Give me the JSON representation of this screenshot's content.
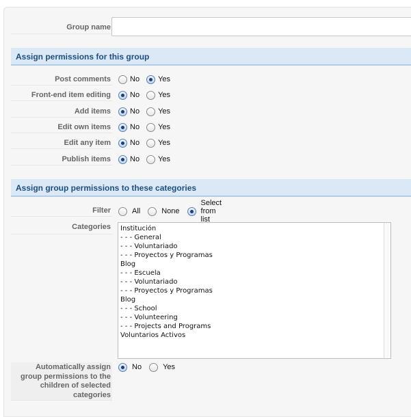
{
  "group_name": {
    "label": "Group name",
    "value": ""
  },
  "section_permissions": {
    "title": "Assign permissions for this group"
  },
  "permissions": [
    {
      "label": "Post comments",
      "options": [
        "No",
        "Yes"
      ],
      "selected": "Yes"
    },
    {
      "label": "Front-end item editing",
      "options": [
        "No",
        "Yes"
      ],
      "selected": "No"
    },
    {
      "label": "Add items",
      "options": [
        "No",
        "Yes"
      ],
      "selected": "No"
    },
    {
      "label": "Edit own items",
      "options": [
        "No",
        "Yes"
      ],
      "selected": "No"
    },
    {
      "label": "Edit any item",
      "options": [
        "No",
        "Yes"
      ],
      "selected": "No"
    },
    {
      "label": "Publish items",
      "options": [
        "No",
        "Yes"
      ],
      "selected": "No"
    }
  ],
  "section_categories": {
    "title": "Assign group permissions to these categories"
  },
  "filter": {
    "label": "Filter",
    "options": [
      "All",
      "None",
      "Select from list"
    ],
    "selected": "Select from list"
  },
  "categories": {
    "label": "Categories",
    "items": [
      "Institución",
      "- - - General",
      "- - - Voluntariado",
      "- - - Proyectos y Programas",
      "Blog",
      "- - - Escuela",
      "- - - Voluntariado",
      "- - - Proyectos y Programas",
      "Blog",
      "- - - School",
      "- - - Volunteering",
      "- - - Projects and Programs",
      "Voluntarios Activos"
    ]
  },
  "auto_assign": {
    "label_lines": [
      "Automatically assign",
      "group permissions to the",
      "children of selected",
      "categories"
    ],
    "options": [
      "No",
      "Yes"
    ],
    "selected": "No"
  }
}
